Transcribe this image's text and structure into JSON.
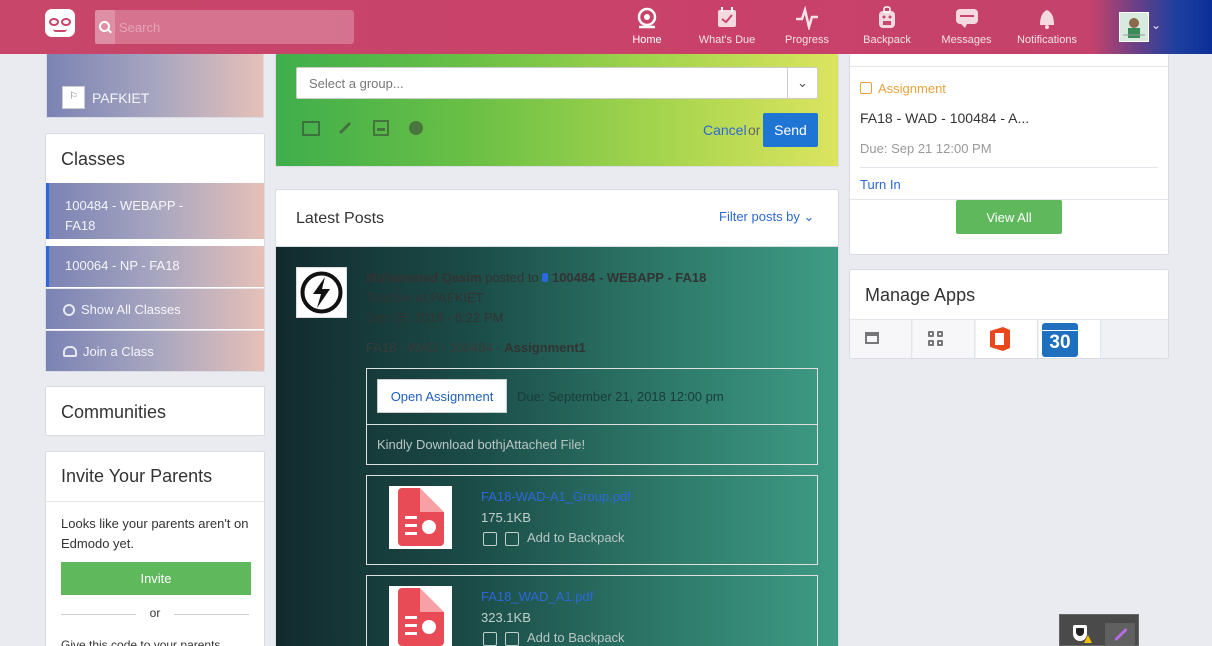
{
  "colors": {
    "accent": "#c8466a",
    "link": "#2d68d8",
    "success": "#5fb85c",
    "primary": "#1f75d4",
    "assignment": "#e8a33d"
  },
  "search": {
    "placeholder": "Search"
  },
  "nav": [
    {
      "label": "Home",
      "icon": "home-icon",
      "active": true
    },
    {
      "label": "What's Due",
      "icon": "calendar-check-icon"
    },
    {
      "label": "Progress",
      "icon": "pulse-icon"
    },
    {
      "label": "Backpack",
      "icon": "backpack-icon"
    },
    {
      "label": "Messages",
      "icon": "message-icon"
    },
    {
      "label": "Notifications",
      "icon": "bell-icon"
    }
  ],
  "school": {
    "name": "PAFKIET"
  },
  "classes": {
    "title": "Classes",
    "items": [
      {
        "label": "100484 - WEBAPP - FA18"
      },
      {
        "label": "100064 - NP - FA18"
      }
    ],
    "show_all": "Show All Classes",
    "join": "Join a Class"
  },
  "communities": {
    "title": "Communities"
  },
  "invite": {
    "title": "Invite Your Parents",
    "text": "Looks like your parents aren't on Edmodo yet.",
    "button": "Invite",
    "or": "or",
    "code_text": "Give this code to your parents"
  },
  "composer": {
    "group_placeholder": "Select a group...",
    "cancel": "Cancel",
    "or": "or",
    "send": "Send"
  },
  "posts": {
    "title": "Latest Posts",
    "filter": "Filter posts by",
    "post": {
      "author": "Muhammad Qasim",
      "posted_to": "posted to",
      "group": "100484 - WEBAPP - FA18",
      "role": "Teacher at PAFKIET",
      "time": "Sep 15, 2018 - 6:22 PM",
      "assignment_prefix": "FA18 - WAD - 100484 -",
      "assignment_name": "Assignment1",
      "open_button": "Open Assignment",
      "due": "Due: September 21, 2018 12:00 pm",
      "note": "Kindly Download bothjAttached File!",
      "files": [
        {
          "name": "FA18-WAD-A1_Group.pdf",
          "size": "175.1KB",
          "action": "Add to Backpack"
        },
        {
          "name": "FA18_WAD_A1.pdf",
          "size": "323.1KB",
          "action": "Add to Backpack"
        }
      ]
    }
  },
  "right": {
    "assignment_label": "Assignment",
    "assignment_title": "FA18 - WAD - 100484 - A...",
    "due": "Due: Sep 21 12:00 PM",
    "turn_in": "Turn In",
    "view_all": "View All"
  },
  "manage_apps": {
    "title": "Manage Apps",
    "apps": [
      "store-icon",
      "grid-icon",
      "office-icon",
      "calendar-icon"
    ],
    "calendar_day": "30"
  }
}
